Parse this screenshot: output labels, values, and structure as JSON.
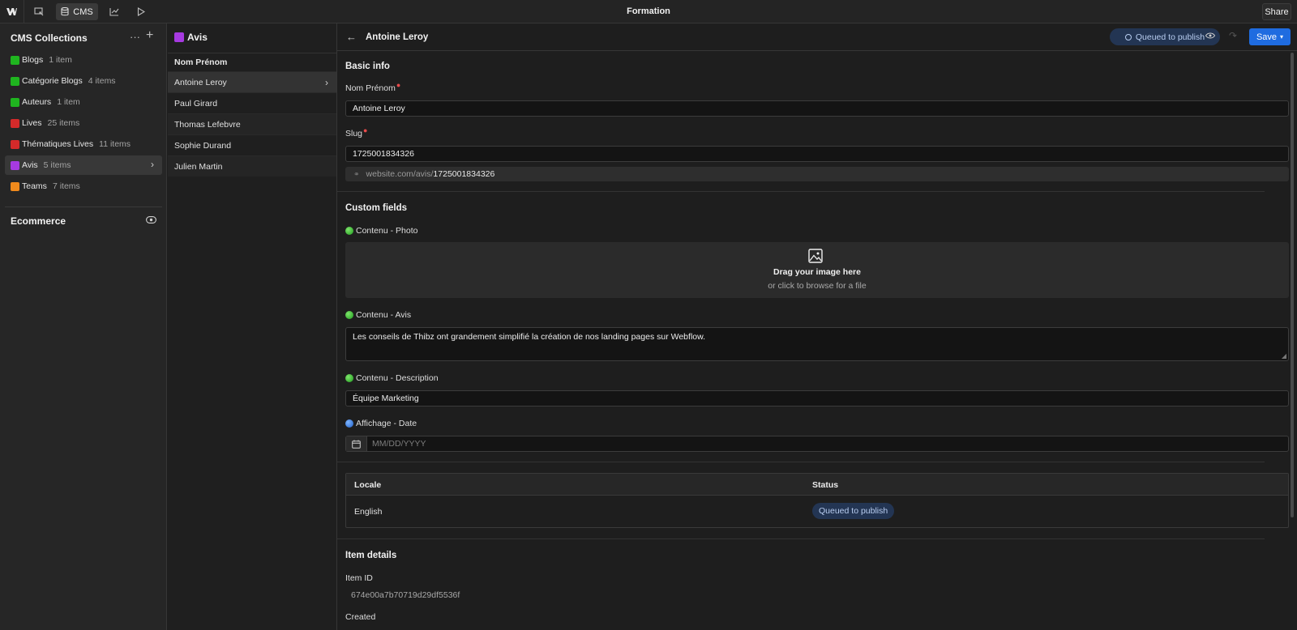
{
  "app": {
    "title": "Formation",
    "share_label": "Share",
    "cms_label": "CMS"
  },
  "sidebar": {
    "title": "CMS Collections",
    "more": "···",
    "add": "+",
    "items": [
      {
        "name": "Blogs",
        "count": "1 item",
        "color": "#1fb51f"
      },
      {
        "name": "Catégorie Blogs",
        "count": "4 items",
        "color": "#1fb51f"
      },
      {
        "name": "Auteurs",
        "count": "1 item",
        "color": "#1fb51f"
      },
      {
        "name": "Lives",
        "count": "25 items",
        "color": "#d42a2a"
      },
      {
        "name": "Thématiques Lives",
        "count": "11 items",
        "color": "#d42a2a"
      },
      {
        "name": "Avis",
        "count": "5 items",
        "color": "#a63ae0"
      },
      {
        "name": "Teams",
        "count": "7 items",
        "color": "#f08a1c"
      }
    ],
    "ecommerce_label": "Ecommerce"
  },
  "list": {
    "collection": "Avis",
    "column_header": "Nom Prénom",
    "rows": [
      "Antoine Leroy",
      "Paul Girard",
      "Thomas Lefebvre",
      "Sophie Durand",
      "Julien Martin"
    ]
  },
  "editor": {
    "title": "Antoine Leroy",
    "status": "Queued to publish",
    "save_label": "Save",
    "basic_info": {
      "title": "Basic info",
      "name_label": "Nom Prénom",
      "name_value": "Antoine Leroy",
      "slug_label": "Slug",
      "slug_value": "1725001834326",
      "slug_url_prefix": "website.com/avis/",
      "slug_url_value": "1725001834326"
    },
    "custom_fields": {
      "title": "Custom fields",
      "photo_label": "Contenu - Photo",
      "drop_main": "Drag your image here",
      "drop_sub": "or click to browse for a file",
      "avis_label": "Contenu - Avis",
      "avis_value": "Les conseils de Thibz ont grandement simplifié la création de nos landing pages sur Webflow.",
      "description_label": "Contenu - Description",
      "description_value": "Équipe Marketing",
      "date_label": "Affichage - Date",
      "date_placeholder": "MM/DD/YYYY"
    },
    "locales": {
      "header_locale": "Locale",
      "header_status": "Status",
      "rows": [
        {
          "locale": "English",
          "status": "Queued to publish"
        }
      ]
    },
    "item_details": {
      "title": "Item details",
      "item_id_label": "Item ID",
      "item_id_value": "674e00a7b70719d29df5536f",
      "created_label": "Created"
    }
  }
}
